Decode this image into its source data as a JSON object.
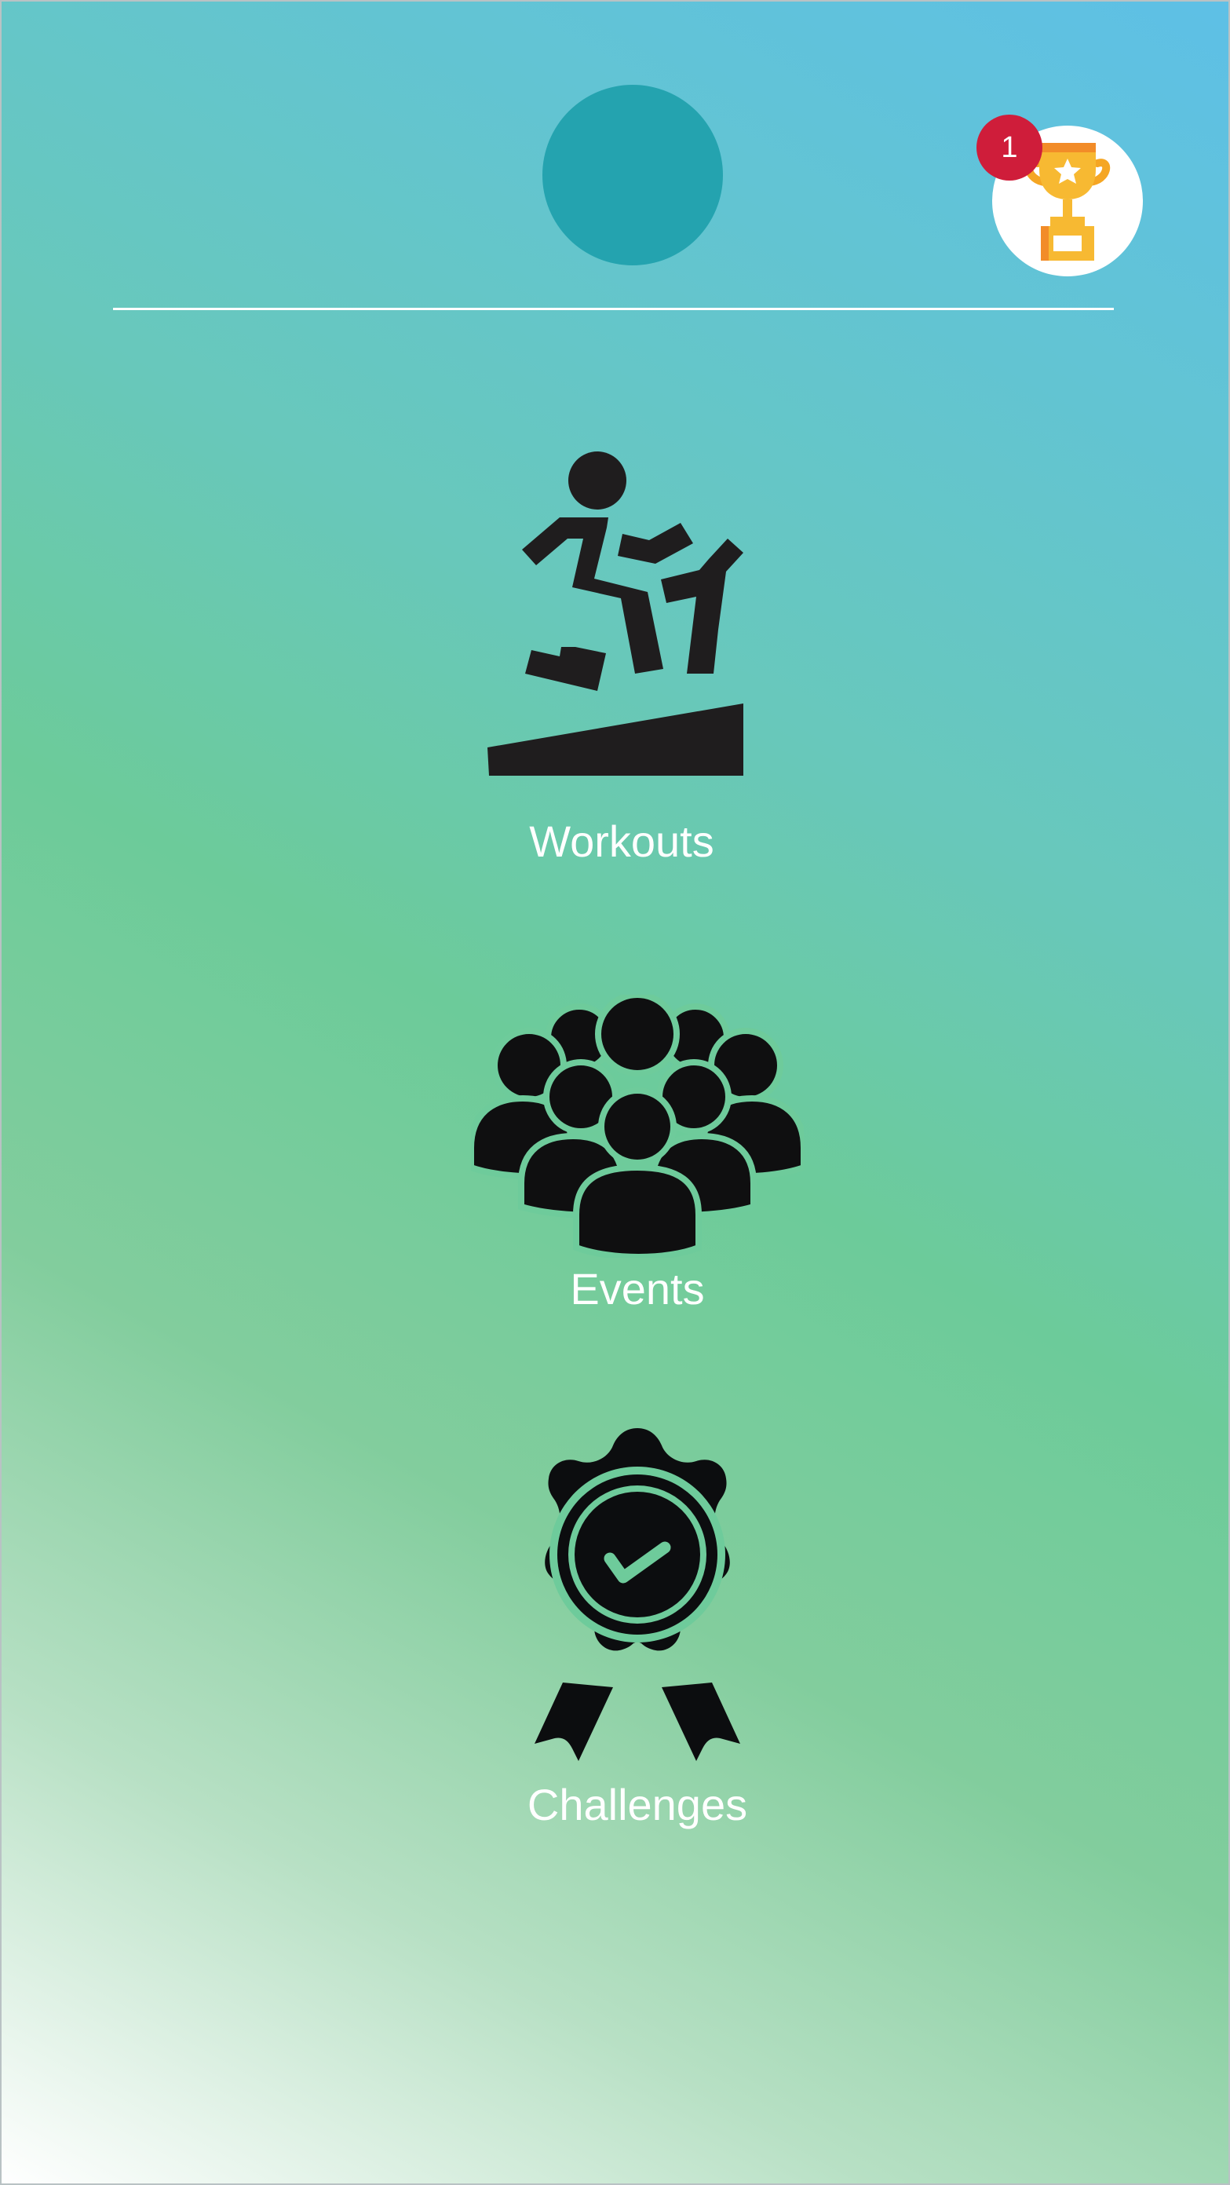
{
  "header": {
    "notification_count": "1",
    "avatar_color": "#24a3af",
    "trophy_icon": "trophy-icon",
    "badge_color": "#cf1d3a"
  },
  "menu": {
    "workouts": {
      "label": "Workouts",
      "icon": "treadmill-runner-icon"
    },
    "events": {
      "label": "Events",
      "icon": "crowd-icon"
    },
    "challenges": {
      "label": "Challenges",
      "icon": "award-badge-icon"
    }
  },
  "colors": {
    "label_text": "#ffffff",
    "icon_fill": "#1f1d1e",
    "divider": "#ffffff"
  }
}
